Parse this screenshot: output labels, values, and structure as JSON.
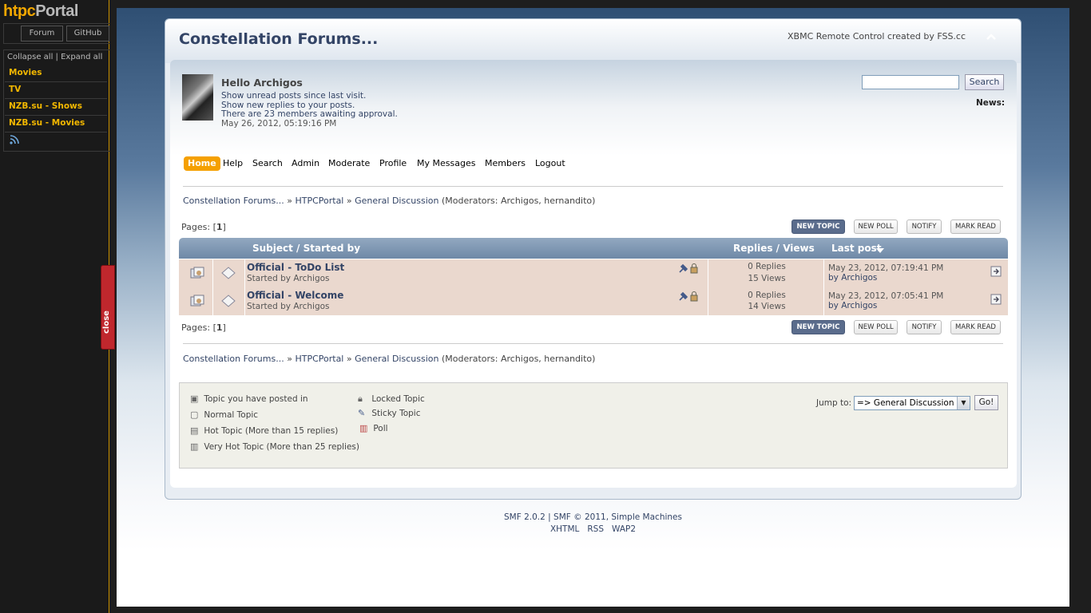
{
  "sidebar": {
    "logo_a": "htpc",
    "logo_b": "Portal",
    "forum_button": "Forum",
    "github_button": "GitHub",
    "collapse_links": "Collapse all | Expand all",
    "items": [
      {
        "label": "Movies"
      },
      {
        "label": "TV"
      },
      {
        "label": "NZB.su - Shows"
      },
      {
        "label": "NZB.su - Movies"
      }
    ],
    "close_tab": "close"
  },
  "header": {
    "title": "Constellation Forums...",
    "credit": "XBMC Remote Control created by FSS.cc",
    "collapse_icon": "chevron-up-icon"
  },
  "user": {
    "greeting": "Hello Archigos",
    "unread_link": "Show unread posts since last visit.",
    "replies_link": "Show new replies to your posts.",
    "approval_link": "There are 23 members awaiting approval.",
    "datetime": "May 26, 2012, 05:19:16 PM"
  },
  "search": {
    "value": "",
    "button": "Search",
    "news_label": "News:"
  },
  "nav": [
    "Home",
    "Help",
    "Search",
    "Admin",
    "Moderate",
    "Profile",
    "My Messages",
    "Members",
    "Logout"
  ],
  "breadcrumb": {
    "items": [
      "Constellation Forums...",
      "HTPCPortal",
      "General Discussion"
    ],
    "separator": "»",
    "moderators": "(Moderators: Archigos, hernandito)"
  },
  "pagination": {
    "label": "Pages: [",
    "current": "1",
    "suffix": "]",
    "buttons": [
      "NEW TOPIC",
      "NEW POLL",
      "NOTIFY",
      "MARK READ"
    ]
  },
  "table": {
    "col_subject": "Subject / Started by",
    "col_replies": "Replies / Views",
    "col_last": "Last post",
    "rows": [
      {
        "subject": "Official - ToDo List",
        "started_by": "Started by Archigos",
        "replies": "0 Replies",
        "views": "15 Views",
        "last_date": "May 23, 2012, 07:19:41 PM",
        "last_by": "by Archigos"
      },
      {
        "subject": "Official - Welcome",
        "started_by": "Started by Archigos",
        "replies": "0 Replies",
        "views": "14 Views",
        "last_date": "May 23, 2012, 07:05:41 PM",
        "last_by": "by Archigos"
      }
    ]
  },
  "legend": {
    "posted": "Topic you have posted in",
    "normal": "Normal Topic",
    "hot": "Hot Topic (More than 15 replies)",
    "very_hot": "Very Hot Topic (More than 25 replies)",
    "locked": "Locked Topic",
    "sticky": "Sticky Topic",
    "poll": "Poll"
  },
  "jump": {
    "label": "Jump to:",
    "selected": "=> General Discussion",
    "go": "Go!"
  },
  "footer": {
    "line1": "SMF 2.0.2 | SMF © 2011, Simple Machines",
    "links": [
      "XHTML",
      "RSS",
      "WAP2"
    ]
  },
  "colors": {
    "accent": "#f5a000",
    "link": "#334466",
    "row_bg": "#ead8ce",
    "close_tab": "#c0272d"
  }
}
